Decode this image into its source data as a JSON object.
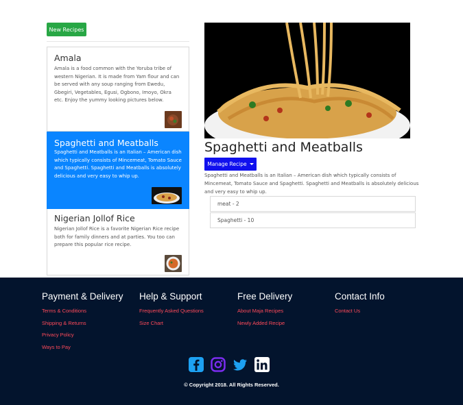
{
  "toolbar": {
    "new_recipes_label": "New Recipes"
  },
  "recipes": [
    {
      "title": "Amala",
      "text": "Amala is a food common with the Yoruba tribe of western Nigerian. It is made from Yam flour and can be served with any soup ranging from Ewedu, Gbegiri, Vegetables, Egusi, Ogbono, Imoyo, Okra etc. Enjoy the yummy looking pictures below."
    },
    {
      "title": "Spaghetti and Meatballs",
      "text": "Spaghetti and Meatballs is an Italian – American dish which typically consists of Mincemeat, Tomato Sauce and Spaghetti. Spaghetti and Meatballs is absolutely delicious and very easy to whip up."
    },
    {
      "title": "Nigerian Jollof Rice",
      "text": "Nigerian Jollof Rice is a favorite Nigerian Rice recipe both for family dinners and at parties. You too can prepare this popular rice recipe."
    }
  ],
  "detail": {
    "title": "Spaghetti and Meatballs",
    "manage_label": "Manage Recipe",
    "description": "Spaghetti and Meatballs is an Italian – American dish which typically consists of Mincemeat, Tomato Sauce and Spaghetti. Spaghetti and Meatballs is absolutely delicious and very easy to whip up.",
    "ingredients": [
      "meat - 2",
      "Spaghetti - 10"
    ]
  },
  "footer": {
    "columns": [
      {
        "heading": "Payment & Delivery",
        "links": [
          "Terms & Conditions",
          "Shipping & Returns",
          "Privacy Policy",
          "Ways to Pay"
        ]
      },
      {
        "heading": "Help & Support",
        "links": [
          "Frequently Asked Questions",
          "Size Chart"
        ]
      },
      {
        "heading": "Free Delivery",
        "links": [
          "About Maja Recipes",
          "Newly Added Recipe"
        ]
      },
      {
        "heading": "Contact Info",
        "links": [
          "Contact Us"
        ]
      }
    ],
    "social_icons": [
      "facebook-icon",
      "instagram-icon",
      "twitter-icon",
      "linkedin-icon"
    ],
    "copyright": "© Copyright 2018. All Rights Reserved."
  },
  "colors": {
    "accent": "#0a85ff",
    "success": "#28a745",
    "primary": "#1010ee",
    "footer_bg": "#03142d",
    "footer_link": "#ff4a5a"
  }
}
